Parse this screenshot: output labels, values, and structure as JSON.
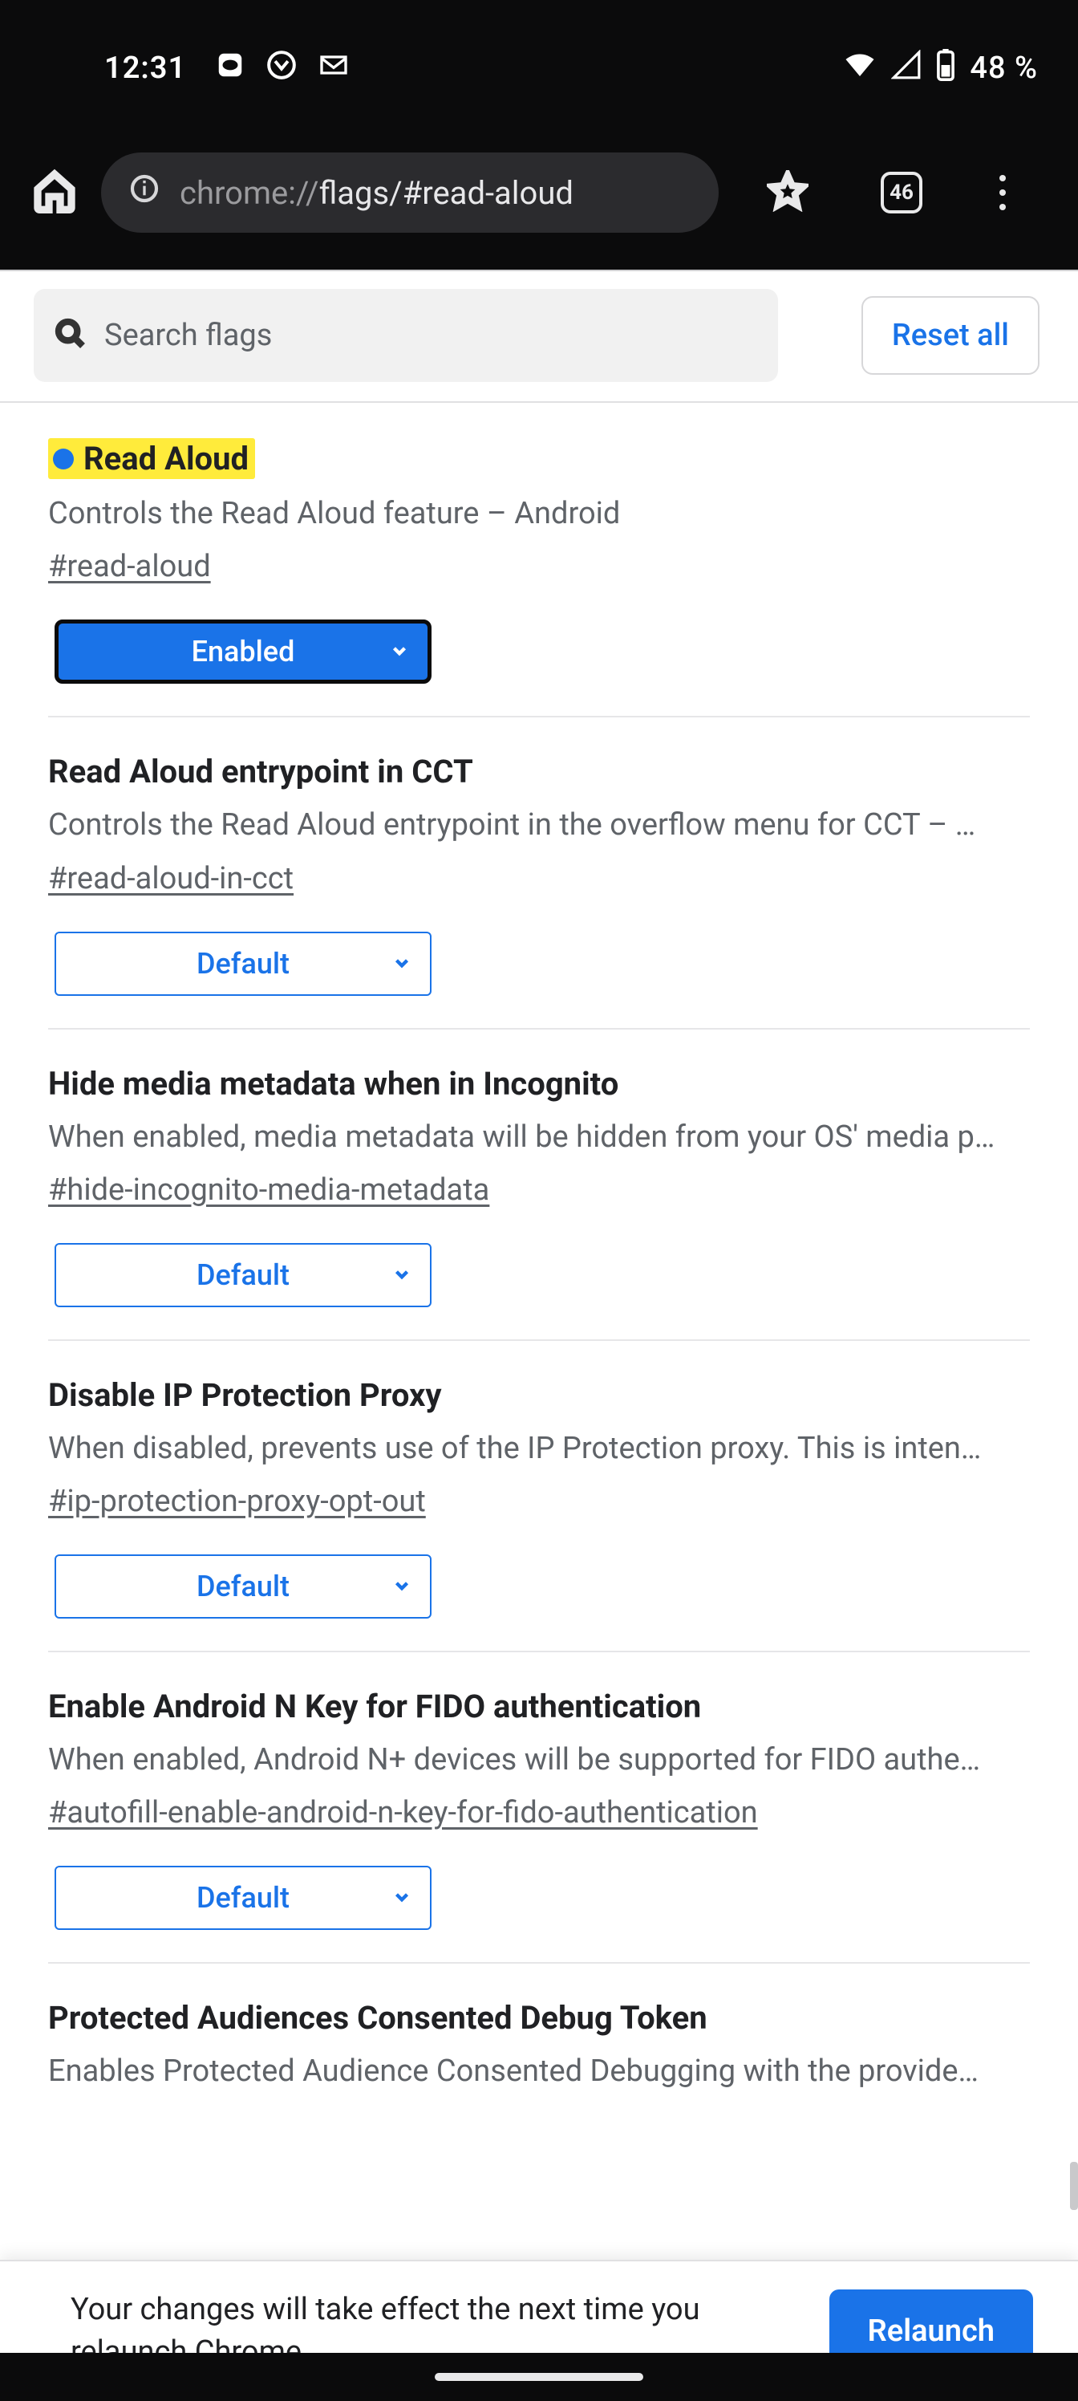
{
  "status": {
    "clock": "12:31",
    "battery_text": "48 %"
  },
  "browser": {
    "url_prefix": "chrome://",
    "url_mid": "flags/",
    "url_frag": "#read-aloud",
    "tab_count": "46"
  },
  "search": {
    "placeholder": "Search flags",
    "reset_label": "Reset all"
  },
  "flags": [
    {
      "title": "Read Aloud",
      "desc": "Controls the Read Aloud feature – Android",
      "anchor": "#read-aloud",
      "select": "Enabled",
      "highlighted": true,
      "enabled_style": true
    },
    {
      "title": "Read Aloud entrypoint in CCT",
      "desc": "Controls the Read Aloud entrypoint in the overflow menu for CCT – …",
      "anchor": "#read-aloud-in-cct",
      "select": "Default"
    },
    {
      "title": "Hide media metadata when in Incognito",
      "desc": "When enabled, media metadata will be hidden from your OS' media p…",
      "anchor": "#hide-incognito-media-metadata",
      "select": "Default"
    },
    {
      "title": "Disable IP Protection Proxy",
      "desc": "When disabled, prevents use of the IP Protection proxy. This is inten…",
      "anchor": "#ip-protection-proxy-opt-out",
      "select": "Default"
    },
    {
      "title": "Enable Android N Key for FIDO authentication",
      "desc": "When enabled, Android N+ devices will be supported for FIDO authe…",
      "anchor": "#autofill-enable-android-n-key-for-fido-authentication",
      "select": "Default"
    },
    {
      "title": "Protected Audiences Consented Debug Token",
      "desc": "Enables Protected Audience Consented Debugging with the provide…",
      "anchor": "",
      "select": ""
    }
  ],
  "relaunch": {
    "message": "Your changes will take effect the next time you relaunch Chrome.",
    "button": "Relaunch"
  }
}
